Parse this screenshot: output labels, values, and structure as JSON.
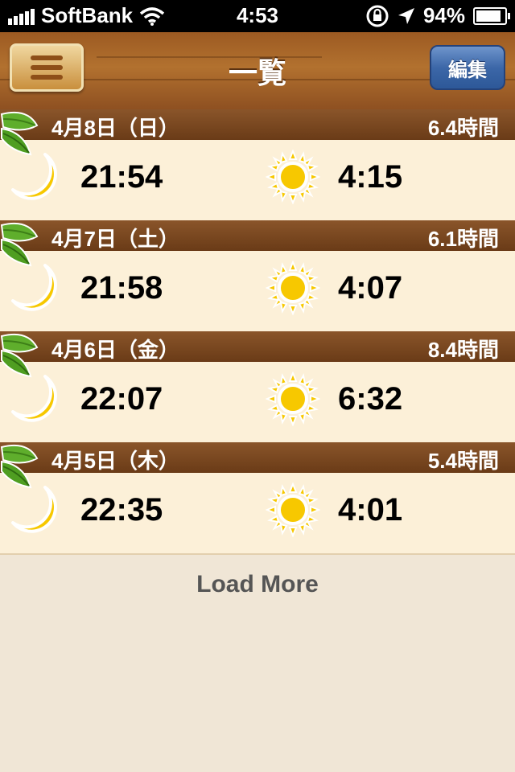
{
  "status_bar": {
    "carrier": "SoftBank",
    "time": "4:53",
    "battery": "94%"
  },
  "nav": {
    "title": "一覧",
    "edit_label": "編集"
  },
  "days": [
    {
      "date": "4月8日（日）",
      "hours": "6.4時間",
      "sleep": "21:54",
      "wake": "4:15"
    },
    {
      "date": "4月7日（土）",
      "hours": "6.1時間",
      "sleep": "21:58",
      "wake": "4:07"
    },
    {
      "date": "4月6日（金）",
      "hours": "8.4時間",
      "sleep": "22:07",
      "wake": "6:32"
    },
    {
      "date": "4月5日（木）",
      "hours": "5.4時間",
      "sleep": "22:35",
      "wake": "4:01"
    }
  ],
  "load_more_label": "Load More",
  "colors": {
    "wood": "#9c5a22",
    "row_bg": "#fcf0d8",
    "page_bg": "#f0e6d6",
    "edit_button": "#3c67a8",
    "icon_yellow": "#f7c800"
  }
}
